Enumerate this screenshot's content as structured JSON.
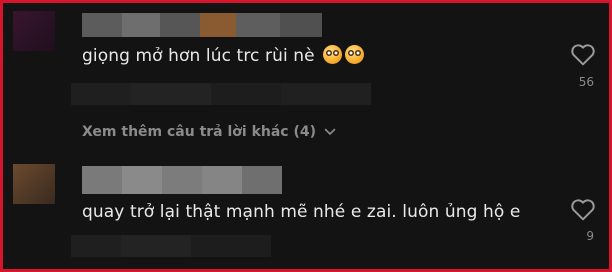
{
  "comments": [
    {
      "text": "giọng mở hơn lúc trc rùi nè",
      "emojis": [
        "flushed-face",
        "flushed-face"
      ],
      "likes": "56"
    },
    {
      "text": "quay trở lại thật mạnh mẽ nhé e zai. luôn ủng hộ e",
      "likes": "9"
    }
  ],
  "more_replies": {
    "label": "Xem thêm câu trả lời khác (4)"
  },
  "colors": {
    "border": "#d4152c",
    "background": "#131313",
    "text": "#e9e9e9",
    "muted": "#8b8b8b"
  }
}
